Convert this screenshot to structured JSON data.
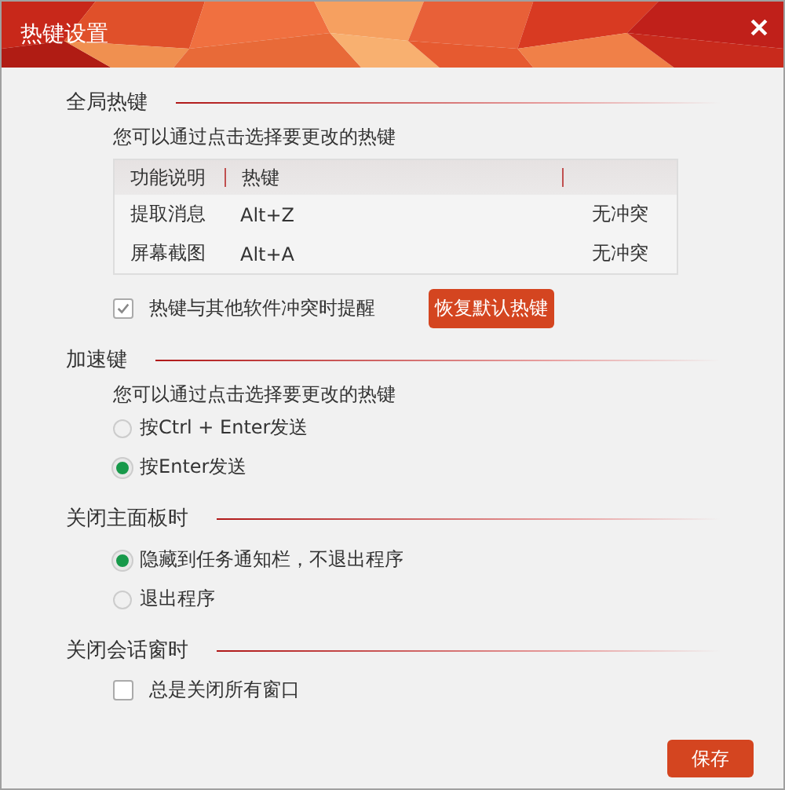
{
  "window": {
    "title": "热键设置"
  },
  "global_hotkeys": {
    "title": "全局热键",
    "hint": "您可以通过点击选择要更改的热键",
    "table": {
      "columns": [
        "功能说明",
        "热键"
      ],
      "rows": [
        {
          "function": "提取消息",
          "hotkey": "Alt+Z",
          "status": "无冲突"
        },
        {
          "function": "屏幕截图",
          "hotkey": "Alt+A",
          "status": "无冲突"
        }
      ]
    },
    "conflict_reminder": {
      "label": "热键与其他软件冲突时提醒",
      "checked": true
    },
    "restore_button": "恢复默认热键"
  },
  "accelerator": {
    "title": "加速键",
    "hint": "您可以通过点击选择要更改的热键",
    "options": [
      {
        "label": "按Ctrl + Enter发送",
        "selected": false
      },
      {
        "label": "按Enter发送",
        "selected": true
      }
    ]
  },
  "close_main_panel": {
    "title": "关闭主面板时",
    "options": [
      {
        "label": "隐藏到任务通知栏，不退出程序",
        "selected": true
      },
      {
        "label": "退出程序",
        "selected": false
      }
    ]
  },
  "close_chat_window": {
    "title": "关闭会话窗时",
    "option": {
      "label": "总是关闭所有窗口",
      "checked": false
    }
  },
  "save_button": "保存"
}
